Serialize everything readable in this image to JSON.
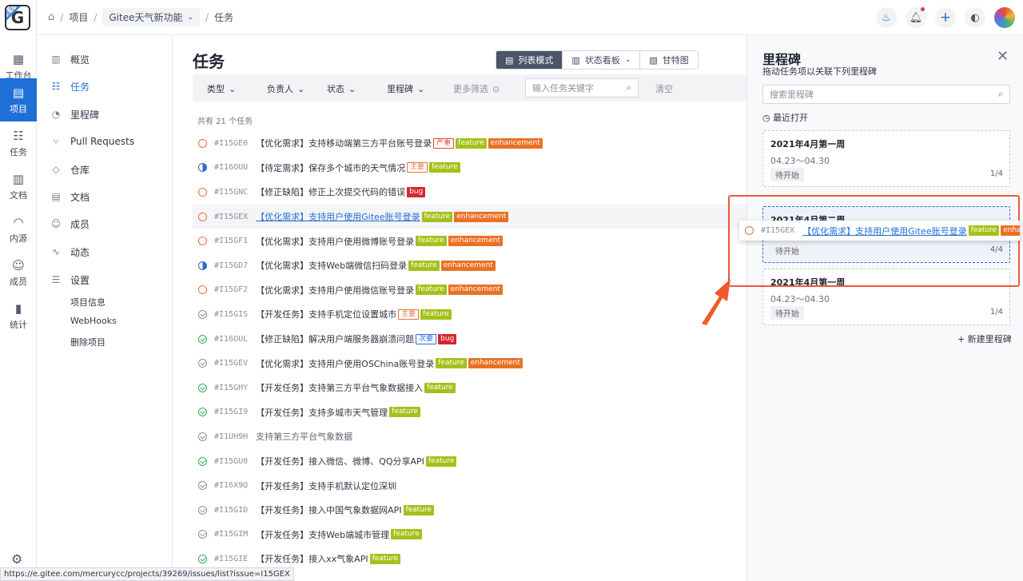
{
  "rail": {
    "logo": "G",
    "logo_badge": "标准版",
    "items": [
      {
        "label": "工作台",
        "icon": "grid-icon"
      },
      {
        "label": "项目",
        "icon": "book-icon"
      },
      {
        "label": "任务",
        "icon": "task-icon"
      },
      {
        "label": "文档",
        "icon": "doc-icon"
      },
      {
        "label": "内源",
        "icon": "source-icon"
      },
      {
        "label": "成员",
        "icon": "people-icon"
      },
      {
        "label": "统计",
        "icon": "chart-icon"
      }
    ]
  },
  "topbar": {
    "crumb_project": "项目",
    "crumb_repo": "Gitee天气新功能",
    "crumb_page": "任务"
  },
  "nav": {
    "items": [
      {
        "label": "概览",
        "icon": "bar-chart-icon"
      },
      {
        "label": "任务",
        "icon": "task-icon"
      },
      {
        "label": "里程碑",
        "icon": "milestone-icon"
      },
      {
        "label": "Pull Requests",
        "icon": "pull-request-icon"
      },
      {
        "label": "仓库",
        "icon": "code-icon"
      },
      {
        "label": "文档",
        "icon": "doc-icon"
      },
      {
        "label": "成员",
        "icon": "user-icon"
      },
      {
        "label": "动态",
        "icon": "activity-icon"
      },
      {
        "label": "设置",
        "icon": "settings-icon"
      }
    ],
    "sub": [
      "项目信息",
      "WebHooks",
      "删除项目"
    ]
  },
  "main": {
    "title": "任务",
    "views": [
      "列表模式",
      "状态看板",
      "甘特图"
    ],
    "filters": [
      "类型",
      "负责人",
      "状态",
      "里程碑"
    ],
    "more_filters": "更多筛选",
    "search_placeholder": "输入任务关键字",
    "clear": "清空",
    "count": "共有 21 个任务"
  },
  "issues": [
    {
      "id": "#I15GE0",
      "title": "【优化需求】支持移动端第三方平台账号登录",
      "status": "doing",
      "labels": [
        {
          "t": "严重",
          "c": "sev"
        },
        {
          "t": "feature",
          "c": "feature"
        },
        {
          "t": "enhancement",
          "c": "enh"
        }
      ]
    },
    {
      "id": "#I16OUU",
      "title": "【待定需求】保存多个城市的天气情况",
      "status": "todo",
      "labels": [
        {
          "t": "主要",
          "c": "major"
        },
        {
          "t": "feature",
          "c": "feature"
        }
      ]
    },
    {
      "id": "#I15GNC",
      "title": "【修正缺陷】修正上次提交代码的错误",
      "status": "doing",
      "labels": [
        {
          "t": "bug",
          "c": "bug"
        }
      ]
    },
    {
      "id": "#I15GEX",
      "title": "【优化需求】支持用户使用Gitee账号登录",
      "status": "doing",
      "link": true,
      "labels": [
        {
          "t": "feature",
          "c": "feature"
        },
        {
          "t": "enhancement",
          "c": "enh"
        }
      ]
    },
    {
      "id": "#I15GF1",
      "title": "【优化需求】支持用户使用微博账号登录",
      "status": "doing",
      "labels": [
        {
          "t": "feature",
          "c": "feature"
        },
        {
          "t": "enhancement",
          "c": "enh"
        }
      ]
    },
    {
      "id": "#I15GD7",
      "title": "【优化需求】支持Web端微信扫码登录",
      "status": "todo",
      "labels": [
        {
          "t": "feature",
          "c": "feature"
        },
        {
          "t": "enhancement",
          "c": "enh"
        }
      ]
    },
    {
      "id": "#I15GF2",
      "title": "【优化需求】支持用户使用微信账号登录",
      "status": "doing",
      "labels": [
        {
          "t": "feature",
          "c": "feature"
        },
        {
          "t": "enhancement",
          "c": "enh"
        }
      ]
    },
    {
      "id": "#I15GIS",
      "title": "【开发任务】支持手机定位设置城市",
      "status": "closed",
      "labels": [
        {
          "t": "主要",
          "c": "major"
        },
        {
          "t": "feature",
          "c": "feature"
        }
      ]
    },
    {
      "id": "#I16OUL",
      "title": "【修正缺陷】解决用户端服务器崩溃问题",
      "status": "done",
      "labels": [
        {
          "t": "次要",
          "c": "minor"
        },
        {
          "t": "bug",
          "c": "bug"
        }
      ]
    },
    {
      "id": "#I15GEV",
      "title": "【优化需求】支持用户使用OSChina账号登录",
      "status": "closed",
      "labels": [
        {
          "t": "feature",
          "c": "feature"
        },
        {
          "t": "enhancement",
          "c": "enh"
        }
      ]
    },
    {
      "id": "#I15GHY",
      "title": "【开发任务】支持第三方平台气象数据接入",
      "status": "done",
      "labels": [
        {
          "t": "feature",
          "c": "feature"
        }
      ]
    },
    {
      "id": "#I15GI9",
      "title": "【开发任务】支持多城市天气管理",
      "status": "done",
      "labels": [
        {
          "t": "feature",
          "c": "feature"
        }
      ]
    },
    {
      "id": "#I1UH9H",
      "title": "支持第三方平台气象数据",
      "status": "closed",
      "muted": true,
      "labels": []
    },
    {
      "id": "#I15GU0",
      "title": "【开发任务】接入微信、微博、QQ分享API",
      "status": "done",
      "labels": [
        {
          "t": "feature",
          "c": "feature"
        }
      ]
    },
    {
      "id": "#I16X9Q",
      "title": "【开发任务】支持手机默认定位深圳",
      "status": "closed",
      "labels": []
    },
    {
      "id": "#I15GID",
      "title": "【开发任务】接入中国气象数据网API",
      "status": "closed",
      "labels": [
        {
          "t": "feature",
          "c": "feature"
        }
      ]
    },
    {
      "id": "#I15GIM",
      "title": "【开发任务】支持Web端城市管理",
      "status": "closed",
      "labels": [
        {
          "t": "feature",
          "c": "feature"
        }
      ]
    },
    {
      "id": "#I15GIE",
      "title": "【开发任务】接入xx气象API",
      "status": "done",
      "labels": [
        {
          "t": "feature",
          "c": "feature"
        }
      ]
    }
  ],
  "panel": {
    "title": "里程碑",
    "subtitle": "拖动任务项以关联下列里程碑",
    "search_placeholder": "搜索里程碑",
    "recent": "最近打开",
    "new_milestone": "新建里程碑",
    "cards": [
      {
        "title": "2021年4月第一周",
        "date": "04.23～04.30",
        "status": "待开始",
        "progress": "1/4"
      },
      {
        "title": "2021年4月第二周",
        "date": "",
        "status": "待开始",
        "progress": "4/4"
      },
      {
        "title": "2021年4月第一周",
        "date": "04.23～04.30",
        "status": "待开始",
        "progress": "1/4"
      }
    ]
  },
  "dragged": {
    "id": "#I15GEX",
    "title": "【优化需求】支持用户使用Gitee账号登录",
    "labels": [
      "feature",
      "enhancement"
    ]
  },
  "status_url": "https://e.gitee.com/mercurycc/projects/39269/issues/list?issue=I15GEX"
}
